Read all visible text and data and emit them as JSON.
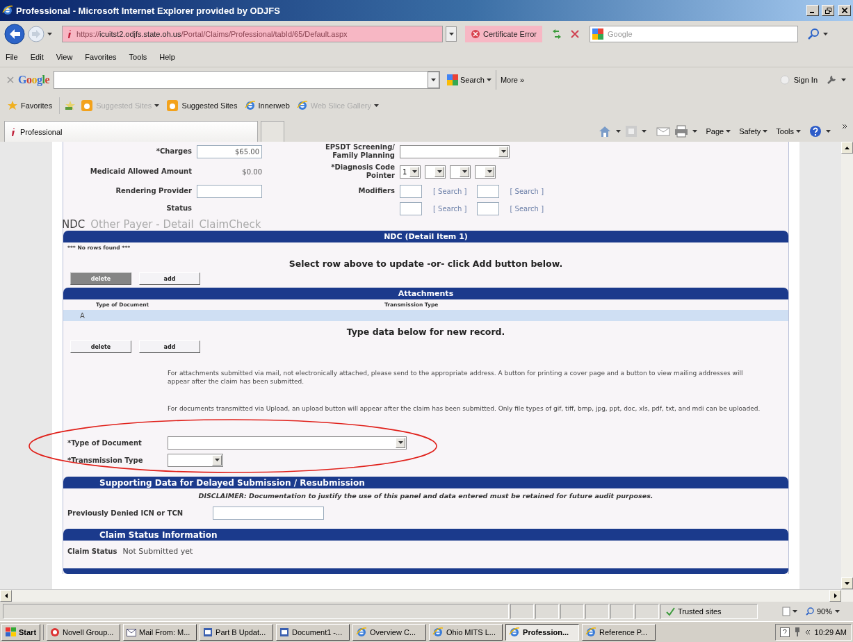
{
  "window": {
    "title": "Professional - Microsoft Internet Explorer provided by ODJFS"
  },
  "address_bar": {
    "url": {
      "scheme": "https://",
      "host": "icuitst2.odjfs.state.oh.us",
      "path": "/Portal/Claims/Professional/tabId/65/Default.aspx"
    },
    "certificate": "Certificate Error",
    "search": {
      "placeholder": "Google"
    }
  },
  "menu": [
    "File",
    "Edit",
    "View",
    "Favorites",
    "Tools",
    "Help"
  ],
  "google_toolbar": {
    "logo": "Google",
    "search": "Search",
    "more": "More »",
    "sign_in": "Sign In"
  },
  "favorites_bar": [
    {
      "label": "Favorites",
      "kind": "star",
      "disabled": false,
      "dropdown": false
    },
    {
      "label": "Suggested Sites",
      "kind": "slice",
      "disabled": true,
      "dropdown": true
    },
    {
      "label": "Suggested Sites",
      "kind": "slice",
      "disabled": false,
      "dropdown": false
    },
    {
      "label": "Innerweb",
      "kind": "page",
      "disabled": false,
      "dropdown": false
    },
    {
      "label": "Web Slice Gallery",
      "kind": "page",
      "disabled": true,
      "dropdown": true
    }
  ],
  "tab": {
    "title": "Professional"
  },
  "command_bar": [
    "Page",
    "Safety",
    "Tools"
  ],
  "form": {
    "detail_rows": [
      {
        "left": {
          "label": "*Charges",
          "kind": "input",
          "value": "$65.00"
        },
        "right": {
          "label": "EPSDT Screening/ Family Planning",
          "kind": "select"
        }
      },
      {
        "left": {
          "label": "Medicaid Allowed Amount",
          "kind": "text",
          "value": "$0.00"
        },
        "right": {
          "label": "*Diagnosis Code Pointer",
          "kind": "pointers",
          "selects": [
            {
              "kind": "value",
              "value": "1"
            },
            {
              "kind": "blank"
            },
            {
              "kind": "blank"
            },
            {
              "kind": "blank"
            }
          ]
        }
      },
      {
        "left": {
          "label": "Rendering Provider",
          "kind": "input"
        },
        "right": {
          "label": "Modifiers",
          "kind": "modifiers",
          "links": [
            "[ Search ]",
            "[ Search ]"
          ]
        }
      },
      {
        "left": {
          "label": "Status",
          "kind": "label"
        },
        "right": {
          "kind": "modifiers",
          "links": [
            "[ Search ]",
            "[ Search ]"
          ]
        }
      }
    ],
    "tabs": [
      {
        "label": "NDC",
        "selected": true
      },
      {
        "label": "Other Payer - Detail",
        "selected": false
      },
      {
        "label": "ClaimCheck",
        "selected": false
      }
    ],
    "ndc": {
      "title": "NDC (Detail Item 1)",
      "empty": "*** No rows found ***",
      "message": "Select row above to update -or- click Add button below.",
      "buttons": [
        {
          "label": "delete",
          "disabled": true
        },
        {
          "label": "add",
          "disabled": false
        }
      ]
    },
    "attachments": {
      "title": "Attachments",
      "columns": [
        "Type of Document",
        "Transmission Type"
      ],
      "rows": [
        {
          "marker": "A",
          "selected": true
        }
      ],
      "message": "Type data below for new record.",
      "buttons": [
        {
          "label": "delete",
          "disabled": false
        },
        {
          "label": "add",
          "disabled": false
        }
      ],
      "notes": [
        "For attachments submitted via mail, not electronically attached, please send to the appropriate address. A button for printing a cover page and a button to view mailing addresses will appear after the claim has been submitted.",
        "For documents transmitted via Upload, an upload button will appear after the claim has been submitted. Only file types of gif, tiff, bmp, jpg, ppt, doc, xls, pdf, txt, and mdi can be uploaded."
      ],
      "fields": [
        {
          "label": "*Type of Document",
          "kind": "select"
        },
        {
          "label": "*Transmission Type",
          "kind": "select"
        }
      ]
    },
    "supporting": {
      "title": "Supporting Data for Delayed Submission / Resubmission",
      "disclaimer": "**DISCLAIMER:** Documentation to justify the use of this panel and data entered must be retained for future audit purposes.",
      "field": {
        "label": "Previously Denied ICN or TCN"
      }
    },
    "claim_status": {
      "title": "Claim Status Information",
      "label": "Claim Status",
      "value": "Not Submitted yet"
    }
  },
  "status_bar": {
    "zone": "Trusted sites",
    "zoom": "90%"
  },
  "taskbar": {
    "start": "Start",
    "items": [
      {
        "label": "Novell Group...",
        "kind": "round",
        "selected": false
      },
      {
        "label": "Mail From: M...",
        "kind": "mail",
        "selected": false
      },
      {
        "label": "Part B Updat...",
        "kind": "doc",
        "selected": false
      },
      {
        "label": "Document1 -...",
        "kind": "doc",
        "selected": false
      },
      {
        "label": "Overview C...",
        "kind": "browser",
        "selected": false
      },
      {
        "label": "Ohio MITS L...",
        "kind": "browser",
        "selected": false
      },
      {
        "label": "Profession...",
        "kind": "browser",
        "selected": true
      },
      {
        "label": "Reference P...",
        "kind": "browser",
        "selected": false
      }
    ],
    "clock": "10:29 AM"
  }
}
